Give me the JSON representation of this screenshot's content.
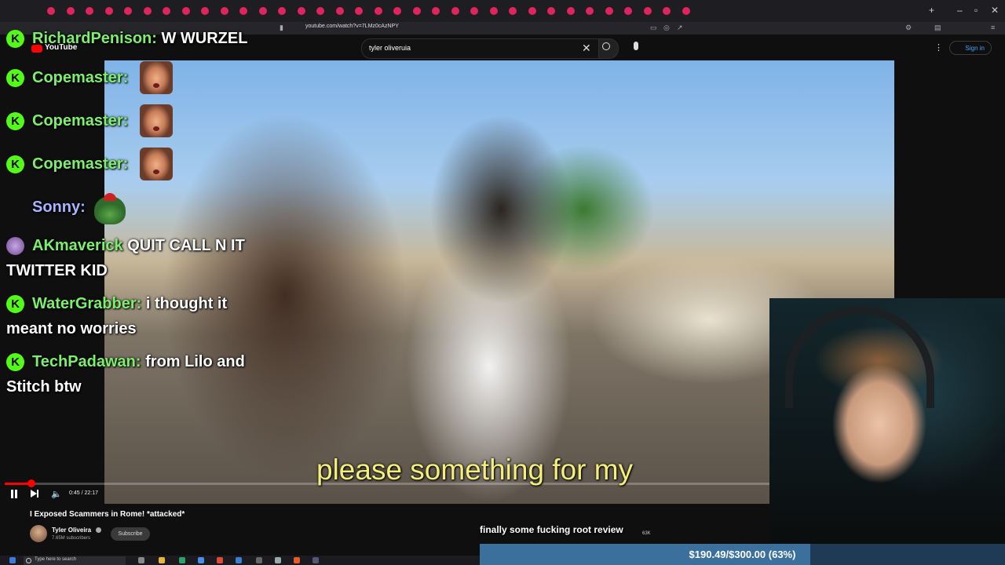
{
  "browser": {
    "url": "youtube.com/watch?v=7LMz0cAzNPY",
    "tab_count": 34
  },
  "youtube": {
    "logo_text": "YouTube",
    "search_value": "tyler oliveruia",
    "sign_in": "Sign in"
  },
  "video": {
    "current_time": "0:45",
    "duration": "22:17",
    "time_display": "0:45 / 22:17",
    "progress": 0.034,
    "subtitle": "please something for my",
    "title": "I Exposed Scammers in Rome! *attacked*",
    "channel_name": "Tyler Oliveira",
    "subscribers": "7.65M subscribers",
    "subscribe_label": "Subscribe",
    "likes": "63K"
  },
  "chat": {
    "messages": [
      {
        "user": "RichardPenison:",
        "text": "W WURZEL",
        "badge": "kick"
      },
      {
        "user": "Copemaster:",
        "text": "",
        "badge": "kick",
        "emote": "face-emote"
      },
      {
        "user": "Copemaster:",
        "text": "",
        "badge": "kick",
        "emote": "face-emote"
      },
      {
        "user": "Copemaster:",
        "text": "",
        "badge": "kick",
        "emote": "face-emote"
      },
      {
        "user": "Sonny:",
        "text": "",
        "badge": "none",
        "emote": "pepe-emote"
      },
      {
        "user": "AKmaverick",
        "text": "QUIT CALL N IT",
        "text2": "TWITTER KID",
        "badge": "avatar"
      },
      {
        "user": "WaterGrabber:",
        "text": "i thought it",
        "text2": "meant no worries",
        "badge": "kick"
      },
      {
        "user": "TechPadawan:",
        "text": "from Lilo and",
        "text2": "Stitch btw",
        "badge": "kick"
      }
    ],
    "badge_letter": "K",
    "colors": {
      "username": "#7cf06c",
      "sonny": "#a7b4ff",
      "kick_badge": "#53fc18"
    }
  },
  "overlay": {
    "goal_title": "finally some fucking root review",
    "goal_label": "$190.49/$300.00 (63%)",
    "goal_current": 190.49,
    "goal_target": 300.0,
    "goal_fraction": 0.63
  },
  "taskbar": {
    "search_placeholder": "Type here to search"
  }
}
